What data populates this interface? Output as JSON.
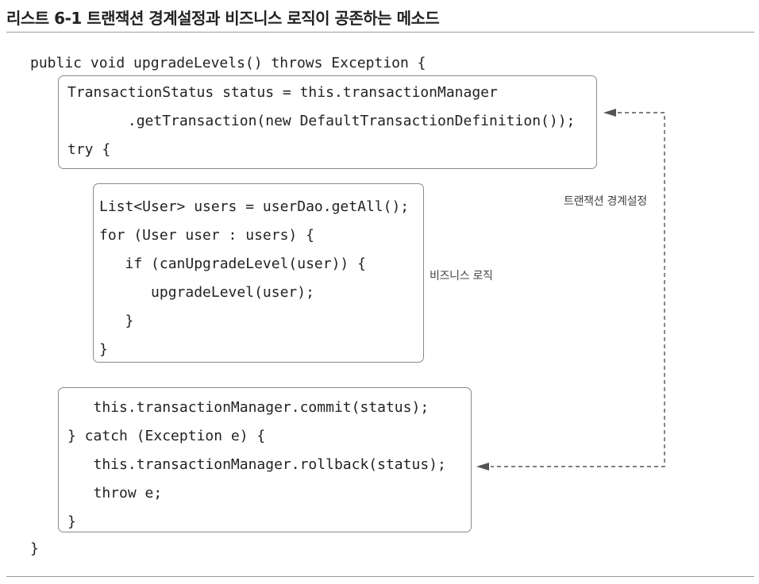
{
  "title": "리스트 6-1 트랜잭션 경계설정과 비즈니스 로직이 공존하는 메소드",
  "code": {
    "method_open": "public void upgradeLevels() throws Exception {",
    "tx_block": [
      "TransactionStatus status = this.transactionManager",
      "       .getTransaction(new DefaultTransactionDefinition());",
      "try {"
    ],
    "biz_block": [
      "List<User> users = userDao.getAll();",
      "for (User user : users) {",
      "   if (canUpgradeLevel(user)) {",
      "      upgradeLevel(user);",
      "   }",
      "}"
    ],
    "commit_block": [
      "   this.transactionManager.commit(status);",
      "} catch (Exception e) {",
      "   this.transactionManager.rollback(status);",
      "   throw e;",
      "}"
    ],
    "method_close": "}"
  },
  "labels": {
    "transaction_boundary": "트랜잭션 경계설정",
    "business_logic": "비즈니스 로직"
  },
  "colors": {
    "text": "#222222",
    "box_border": "#8a8a8a",
    "arrow": "#555555",
    "rule": "#9a9a9a"
  }
}
